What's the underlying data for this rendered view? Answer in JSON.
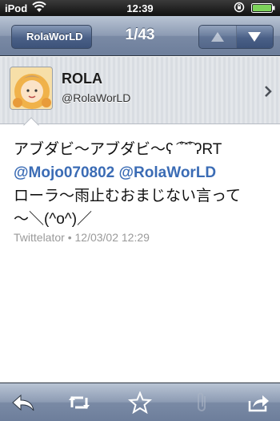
{
  "status_bar": {
    "carrier": "iPod",
    "time": "12:39"
  },
  "nav": {
    "back_label": "RolaWorLD",
    "title": "1/43",
    "prev_icon": "triangle-up-icon",
    "next_icon": "triangle-down-icon"
  },
  "user": {
    "name": "ROLA",
    "handle": "@RolaWorLD"
  },
  "tweet": {
    "text_line1": "アブダビ〜アブダビ〜ʕ ͡ ̊ ͡ ̊ ʔRT",
    "mention1": "@Mojo070802",
    "mention2": "@RolaWorLD",
    "text_line3": "ローラ〜雨止むおまじない言って",
    "text_line4": "〜＼(^o^)／",
    "client": "Twittelator",
    "separator": "•",
    "timestamp": "12/03/02 12:29"
  },
  "toolbar": {
    "items": [
      "reply-icon",
      "retweet-icon",
      "favorite-star-icon",
      "attachment-icon",
      "share-icon"
    ]
  },
  "colors": {
    "mention": "#3b6cb5",
    "nav_bar": "#8c9bb3",
    "meta_text": "#9a9a9a"
  }
}
